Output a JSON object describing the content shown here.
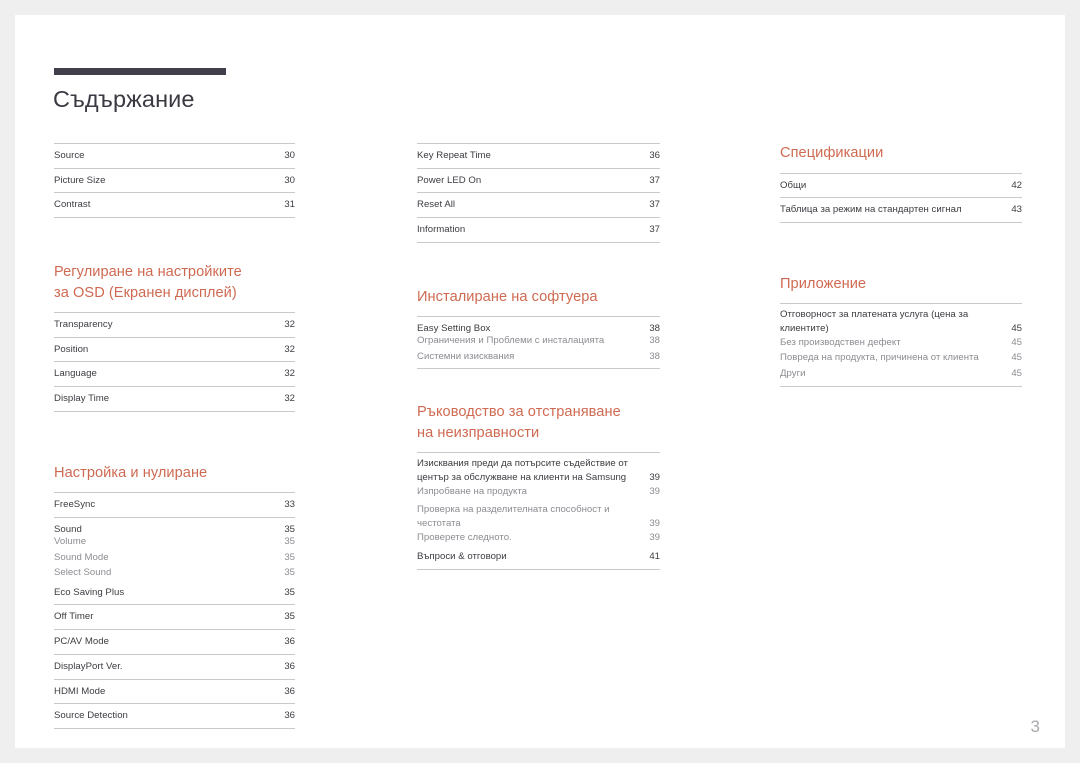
{
  "document": {
    "title": "Съдържание",
    "folio": "3",
    "accent_color": "#cf6a52",
    "rule_color": "#413f4a",
    "body_color": "#3c3c42",
    "sub_color": "#8c8c92",
    "divider_color": "#c9c9c9",
    "page_background": "#ffffff",
    "canvas_background": "#efefef"
  },
  "columns": [
    {
      "id": "left",
      "sections": [
        {
          "heading": null,
          "entries": [
            {
              "label": "Source",
              "page": "30",
              "level": "item"
            },
            {
              "label": "Picture Size",
              "page": "30",
              "level": "item"
            },
            {
              "label": "Contrast",
              "page": "31",
              "level": "item"
            }
          ]
        },
        {
          "heading": "Регулиране на настройките\nза OSD (Екранен дисплей)",
          "entries": [
            {
              "label": "Transparency",
              "page": "32",
              "level": "item"
            },
            {
              "label": "Position",
              "page": "32",
              "level": "item"
            },
            {
              "label": "Language",
              "page": "32",
              "level": "item"
            },
            {
              "label": "Display Time",
              "page": "32",
              "level": "item"
            }
          ]
        },
        {
          "heading": "Настройка и нулиране",
          "entries": [
            {
              "label": "FreeSync",
              "page": "33",
              "level": "item"
            },
            {
              "label": "Sound",
              "page": "35",
              "level": "parent"
            },
            {
              "label": "Volume",
              "page": "35",
              "level": "sub"
            },
            {
              "label": "Sound Mode",
              "page": "35",
              "level": "sub"
            },
            {
              "label": "Select Sound",
              "page": "35",
              "level": "sub"
            },
            {
              "label": "Eco Saving Plus",
              "page": "35",
              "level": "item"
            },
            {
              "label": "Off Timer",
              "page": "35",
              "level": "item"
            },
            {
              "label": "PC/AV Mode",
              "page": "36",
              "level": "item"
            },
            {
              "label": "DisplayPort Ver.",
              "page": "36",
              "level": "item"
            },
            {
              "label": "HDMI Mode",
              "page": "36",
              "level": "item"
            },
            {
              "label": "Source Detection",
              "page": "36",
              "level": "item"
            }
          ]
        }
      ]
    },
    {
      "id": "middle",
      "sections": [
        {
          "heading": null,
          "entries": [
            {
              "label": "Key Repeat Time",
              "page": "36",
              "level": "item"
            },
            {
              "label": "Power LED On",
              "page": "37",
              "level": "item"
            },
            {
              "label": "Reset All",
              "page": "37",
              "level": "item"
            },
            {
              "label": "Information",
              "page": "37",
              "level": "item"
            }
          ]
        },
        {
          "heading": "Инсталиране на софтуера",
          "entries": [
            {
              "label": "Easy Setting Box",
              "page": "38",
              "level": "parent"
            },
            {
              "label": "Ограничения и Проблеми с инсталацията",
              "page": "38",
              "level": "sub"
            },
            {
              "label": "Системни изисквания",
              "page": "38",
              "level": "sub"
            }
          ]
        },
        {
          "heading": "Ръководство за отстраняване\nна неизправности",
          "entries": [
            {
              "label": "Изисквания преди да потърсите съдействие от център за обслужване на клиенти на Samsung",
              "line1": "Изисквания преди да потърсите съдействие от",
              "line2": "център за обслужване на клиенти на Samsung",
              "page": "39",
              "level": "parent-wrap"
            },
            {
              "label": "Изпробване на продукта",
              "page": "39",
              "level": "sub"
            },
            {
              "label": "Проверка на разделителната способност и честотата",
              "line1": "Проверка на разделителната способност и",
              "line2": "честотата",
              "page": "39",
              "level": "sub-wrap"
            },
            {
              "label": "Проверете следното.",
              "page": "39",
              "level": "sub"
            },
            {
              "label": "Въпроси & отговори",
              "page": "41",
              "level": "item"
            }
          ]
        }
      ]
    },
    {
      "id": "right",
      "sections": [
        {
          "heading": "Спецификации",
          "entries": [
            {
              "label": "Общи",
              "page": "42",
              "level": "item"
            },
            {
              "label": "Таблица за режим на стандартен сигнал",
              "page": "43",
              "level": "item"
            }
          ]
        },
        {
          "heading": "Приложение",
          "entries": [
            {
              "label": "Отговорност за платената услуга (цена за клиентите)",
              "line1": "Отговорност за платената услуга (цена за",
              "line2": "клиентите)",
              "page": "45",
              "level": "parent-wrap"
            },
            {
              "label": "Без производствен дефект",
              "page": "45",
              "level": "sub"
            },
            {
              "label": "Повреда на продукта, причинена от клиента",
              "page": "45",
              "level": "sub"
            },
            {
              "label": "Други",
              "page": "45",
              "level": "sub"
            }
          ]
        }
      ]
    }
  ]
}
